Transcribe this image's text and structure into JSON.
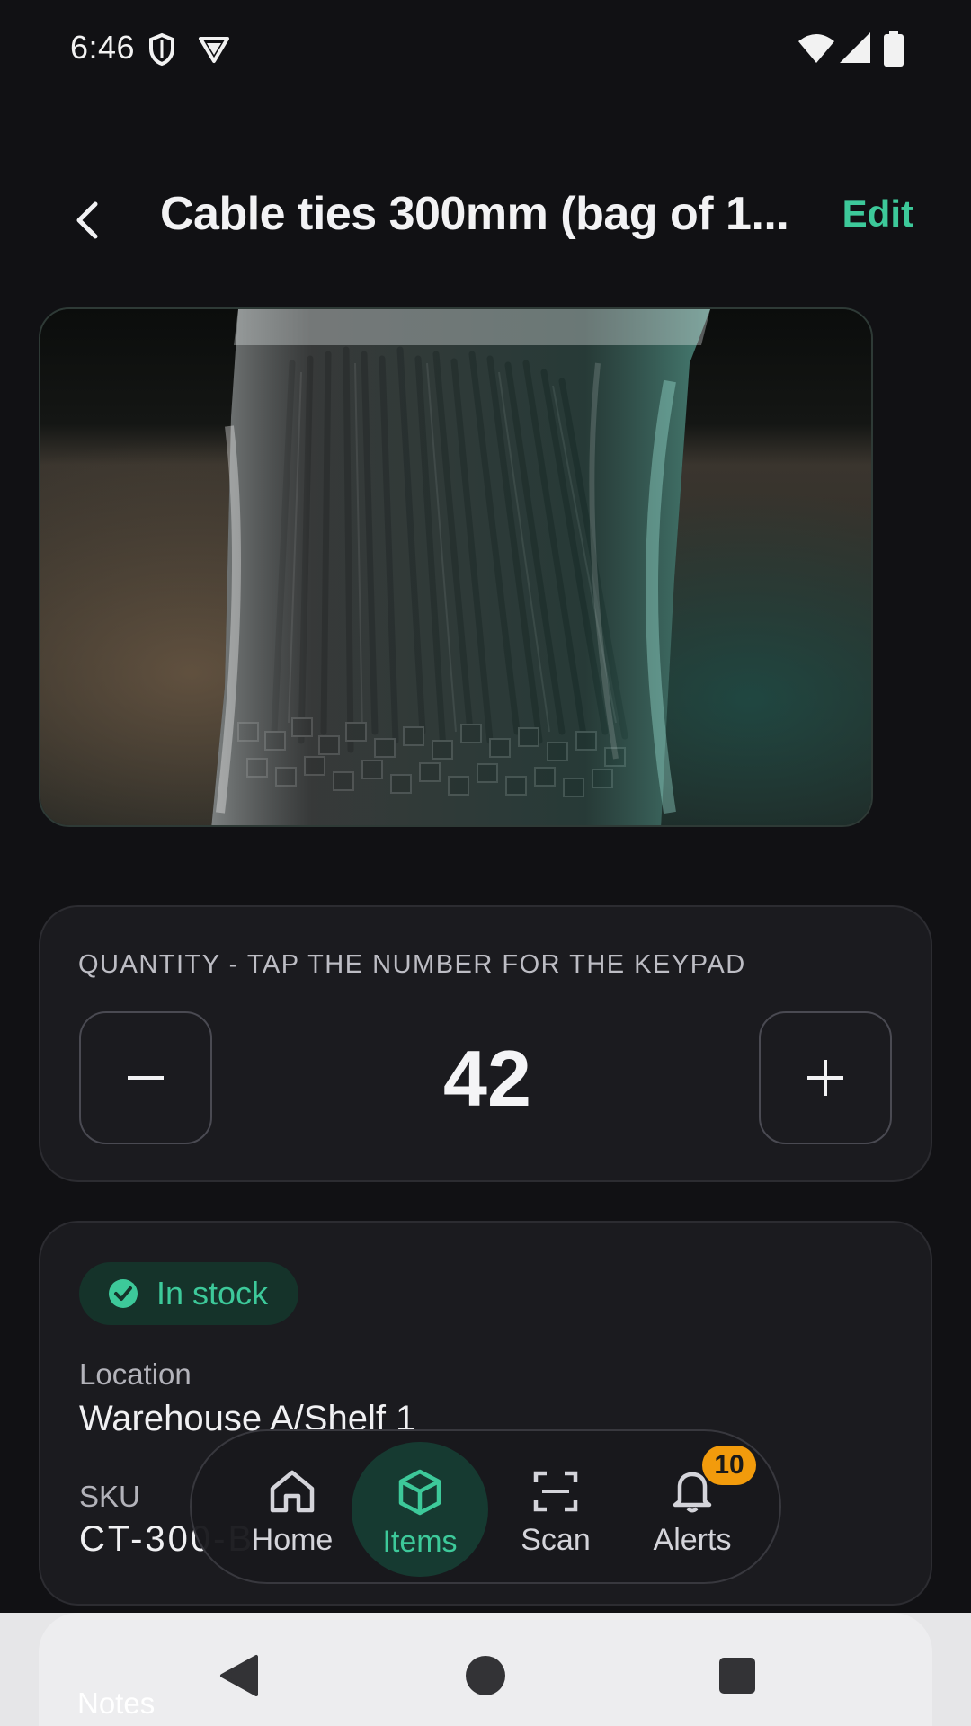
{
  "status_bar": {
    "time": "6:46"
  },
  "app_bar": {
    "title": "Cable ties 300mm (bag of 1...",
    "edit_label": "Edit"
  },
  "quantity": {
    "caption": "QUANTITY - TAP THE NUMBER FOR THE KEYPAD",
    "value": "42"
  },
  "details": {
    "stock_status": "In stock",
    "location_label": "Location",
    "location_value": "Warehouse A/Shelf 1",
    "sku_label": "SKU",
    "sku_value": "CT-300-B"
  },
  "notes": {
    "label": "Notes"
  },
  "bottom_nav": {
    "items": [
      {
        "label": "Home",
        "icon": "home-icon",
        "active": false
      },
      {
        "label": "Items",
        "icon": "box-icon",
        "active": true
      },
      {
        "label": "Scan",
        "icon": "scan-icon",
        "active": false
      },
      {
        "label": "Alerts",
        "icon": "bell-icon",
        "active": false,
        "badge": "10"
      }
    ]
  },
  "colors": {
    "accent": "#3DC99A",
    "background": "#111114",
    "card": "#1B1B1F",
    "badge": "#F29B0C"
  }
}
